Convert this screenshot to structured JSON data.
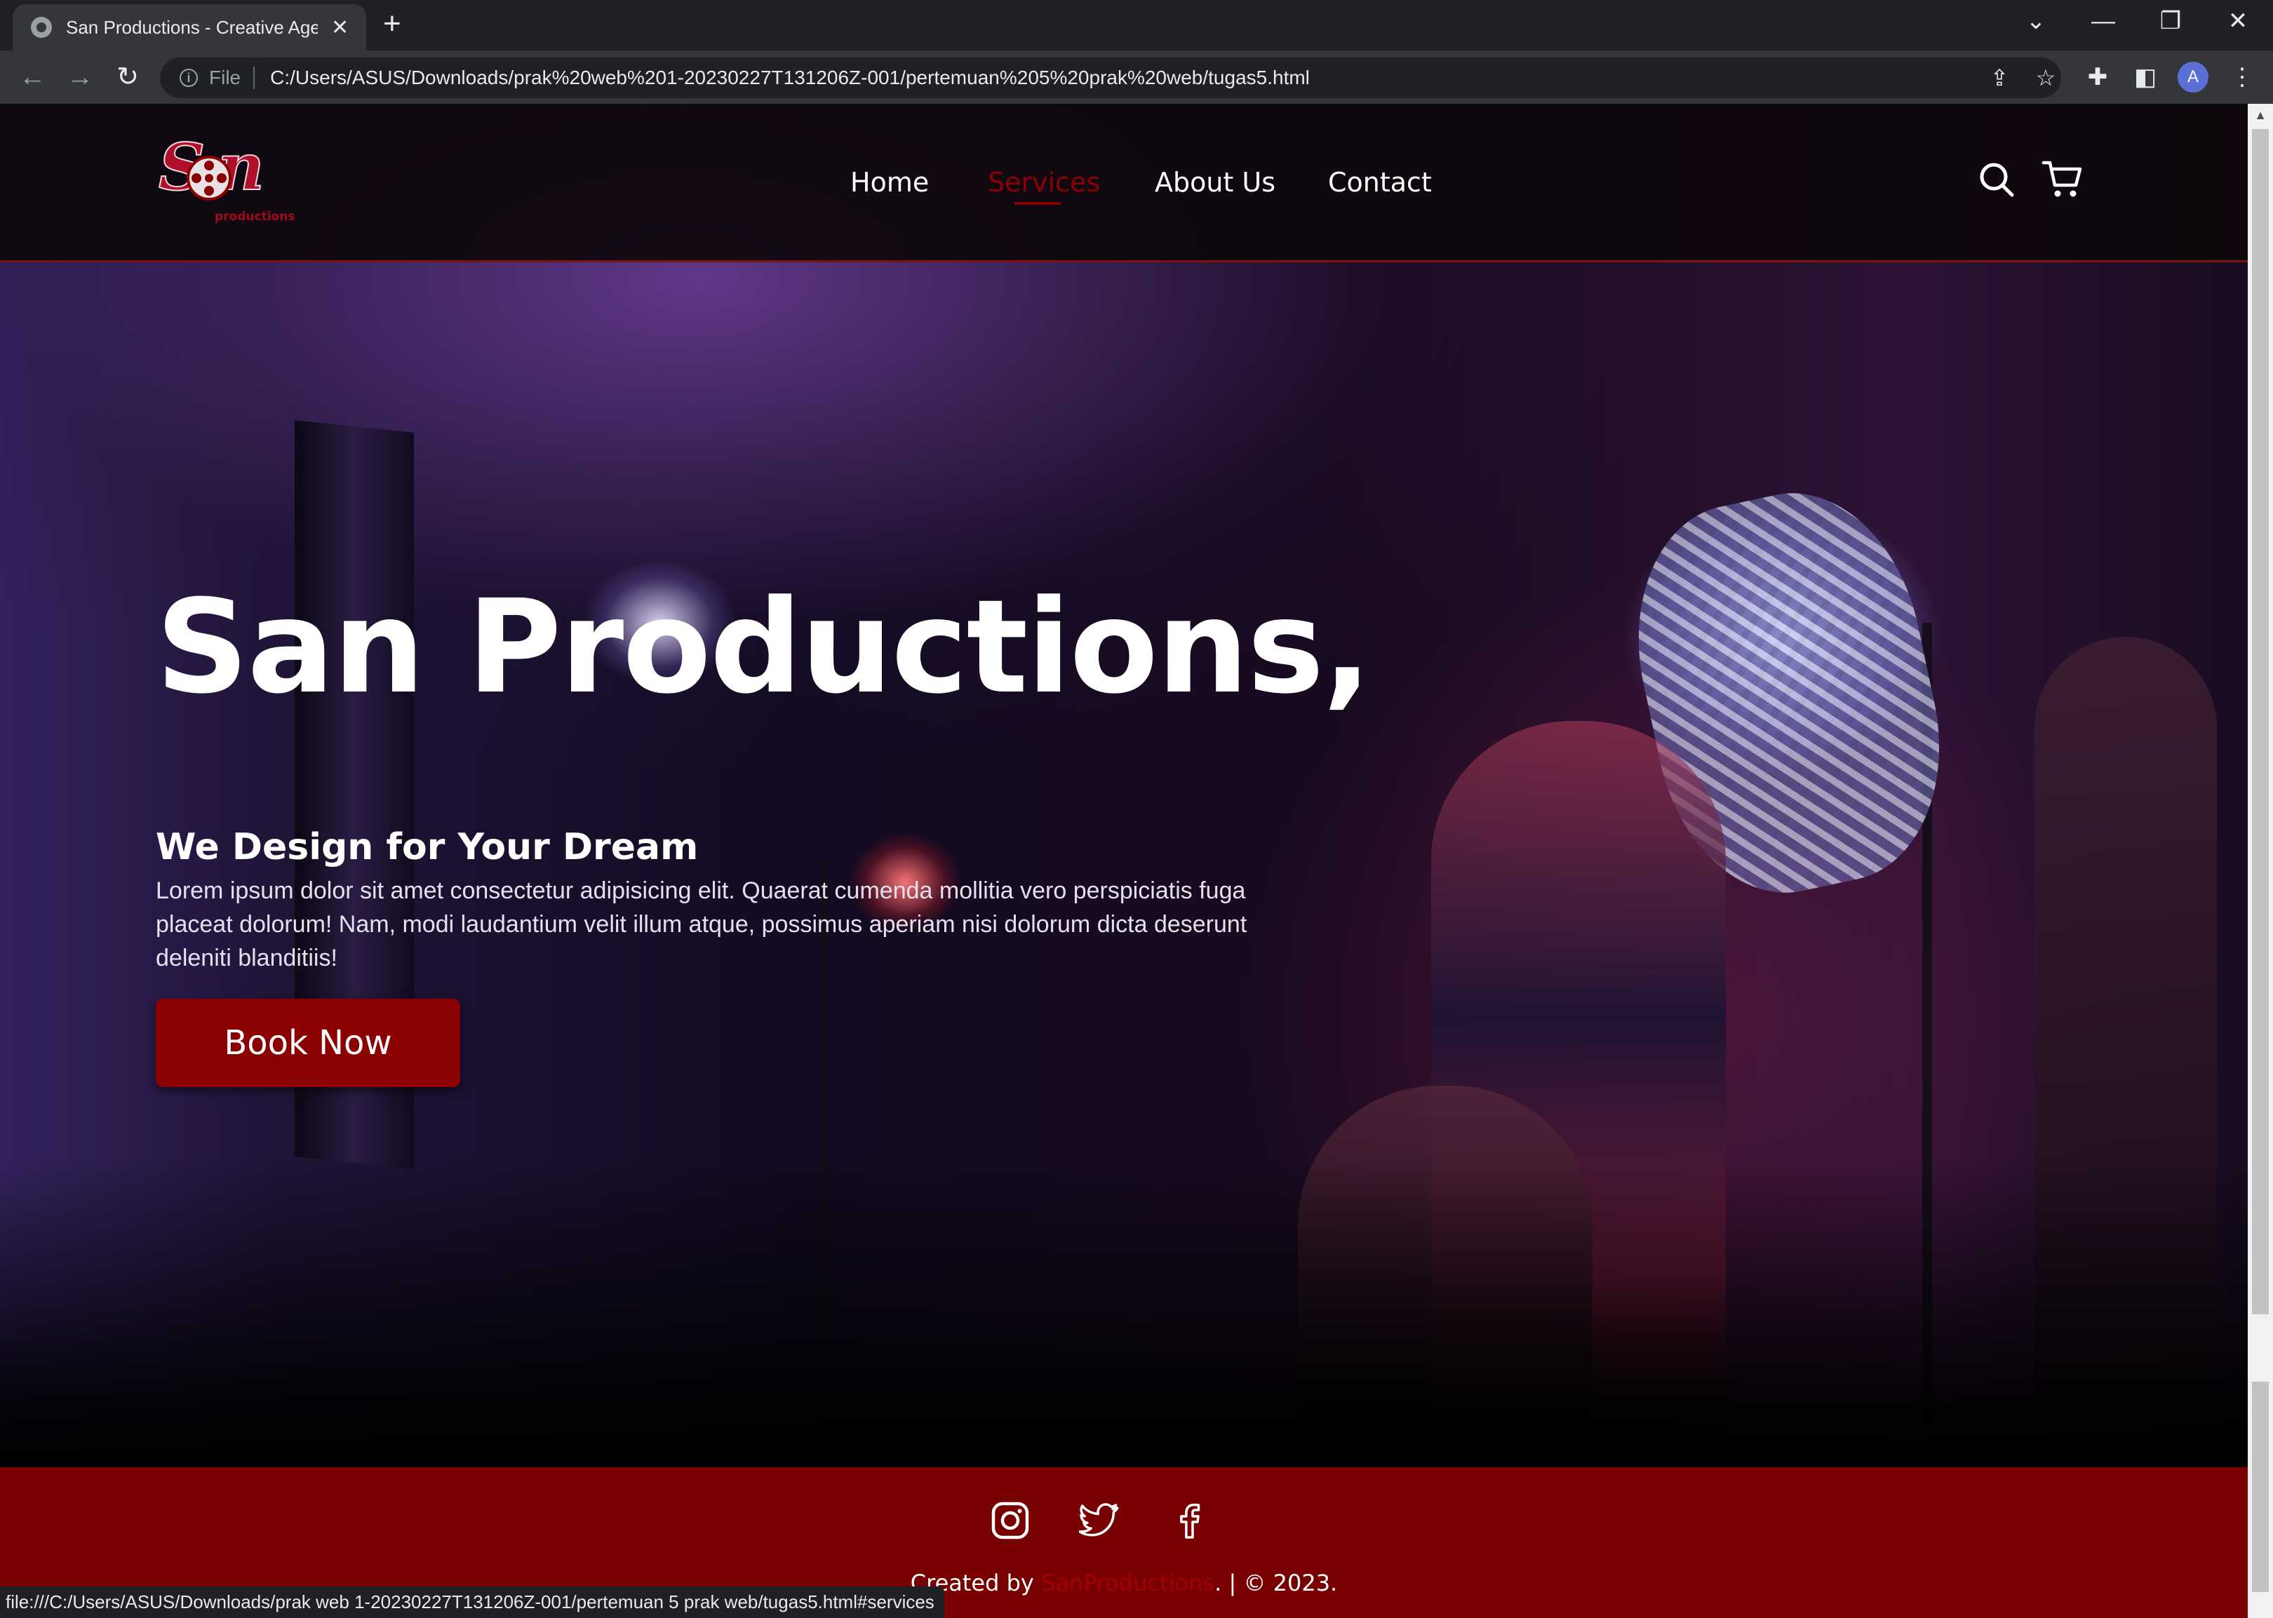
{
  "browser": {
    "tab_title": "San Productions - Creative Agenc",
    "tab_close_glyph": "✕",
    "new_tab_glyph": "+",
    "back_glyph": "←",
    "forward_glyph": "→",
    "reload_glyph": "↻",
    "file_label": "File",
    "url": "C:/Users/ASUS/Downloads/prak%20web%201-20230227T131206Z-001/pertemuan%205%20prak%20web/tugas5.html",
    "profile_initial": "A",
    "status_url": "file:///C:/Users/ASUS/Downloads/prak web 1-20230227T131206Z-001/pertemuan 5 prak web/tugas5.html#services",
    "icons": [
      "globe-icon",
      "close-icon",
      "plus-icon",
      "back-icon",
      "forward-icon",
      "reload-icon",
      "info-icon",
      "share-icon",
      "star-icon",
      "extensions-icon",
      "side-panel-icon",
      "menu-icon",
      "chevron-down-icon",
      "minimize-icon",
      "restore-icon",
      "close-window-icon"
    ]
  },
  "header": {
    "logo_text": "productions",
    "nav": [
      {
        "label": "Home",
        "active": false
      },
      {
        "label": "Services",
        "active": true
      },
      {
        "label": "About Us",
        "active": false
      },
      {
        "label": "Contact",
        "active": false
      }
    ],
    "icons": [
      "search-icon",
      "cart-icon"
    ]
  },
  "hero": {
    "title": "San Productions,",
    "subtitle": "We Design for Your Dream",
    "description": "Lorem ipsum dolor sit amet consectetur adipisicing elit. Quaerat cumenda mollitia vero perspiciatis fuga placeat dolorum! Nam, modi laudantium velit illum atque, possimus aperiam nisi dolorum dicta deserunt deleniti blanditiis!",
    "button_label": "Book Now"
  },
  "footer": {
    "social": [
      "instagram-icon",
      "twitter-icon",
      "facebook-icon"
    ],
    "credit_prefix": "Created by ",
    "credit_brand": "SanProductions",
    "credit_suffix": ". | © 2023."
  },
  "colors": {
    "accent": "#8b0000",
    "footer_bg": "#780000",
    "header_bg": "#0e080c",
    "text": "#ffffff"
  }
}
